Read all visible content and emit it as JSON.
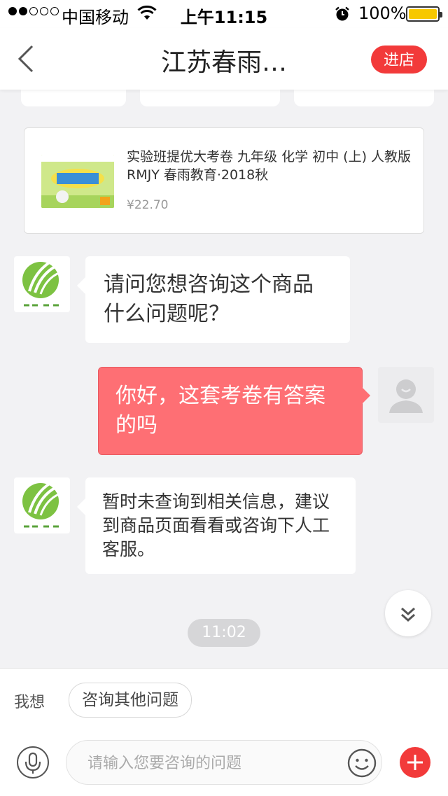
{
  "status_bar": {
    "carrier": "中国移动",
    "time": "上午11:15",
    "battery": "100%"
  },
  "nav": {
    "title": "江苏春雨…",
    "shop_button": "进店"
  },
  "product": {
    "title": "实验班提优大考卷 九年级 化学 初中 (上) 人教版RMJY  春雨教育·2018秋",
    "price": "¥22.70"
  },
  "messages": [
    {
      "from": "shop",
      "text": "请问您想咨询这个商品什么问题呢？"
    },
    {
      "from": "user",
      "text": "你好，这套考卷有答案的吗"
    },
    {
      "from": "shop",
      "text": "暂时未查询到相关信息，建议到商品页面看看或咨询下人工客服。"
    }
  ],
  "timestamp": "11:02",
  "suggest": {
    "label": "我想",
    "chip": "咨询其他问题"
  },
  "input": {
    "placeholder": "请输入您要咨询的问题"
  },
  "colors": {
    "accent": "#f23a3a",
    "user_bubble": "#fe6f74",
    "logo_green": "#7dc242"
  }
}
